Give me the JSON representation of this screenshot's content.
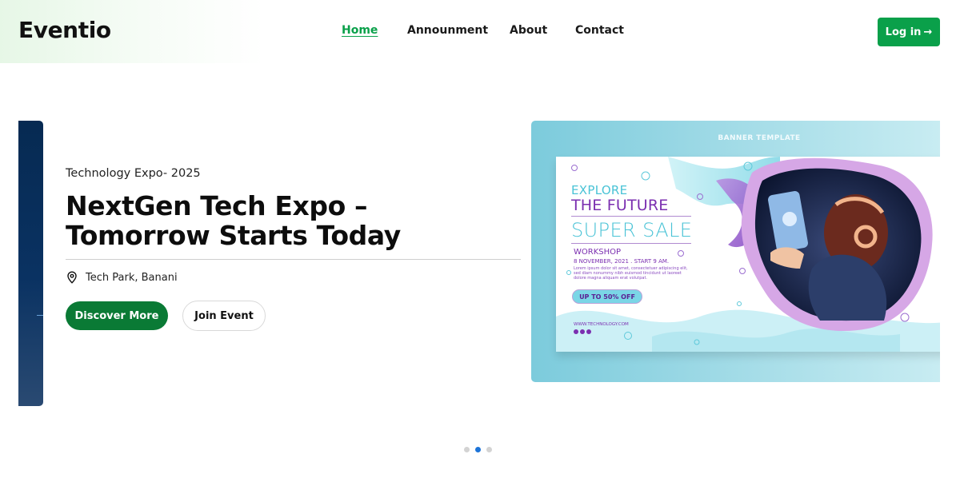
{
  "header": {
    "logo": "Eventio",
    "nav": [
      {
        "label": "Home",
        "active": true
      },
      {
        "label": "Announment",
        "active": false
      },
      {
        "label": "About",
        "active": false
      },
      {
        "label": "Contact",
        "active": false
      }
    ],
    "login_label": "Log in",
    "login_arrow": "→"
  },
  "hero": {
    "subtitle": "Technology Expo-  2025",
    "headline": "NextGen Tech Expo – Tomorrow Starts Today",
    "location": "Tech Park, Banani",
    "discover_label": "Discover More",
    "join_label": "Join Event",
    "banner": {
      "caption": "BANNER TEMPLATE",
      "explore": "EXPLORE",
      "future": "THE FUTURE",
      "sale": "SUPER SALE",
      "workshop": "WORKSHOP",
      "date": "8 NOVEMBER, 2021 . START 9 AM.",
      "lorem": "Lorem ipsum dolor sit amet, consectetuer adipiscing elit, sed diam nonummy nibh euismod tincidunt ut laoreet dolore magna aliquam erat volutpat.",
      "offer": "UP TO 50% OFF",
      "site": "WWW.TECHNOLOGY.COM"
    }
  },
  "slider": {
    "active_index": 1,
    "count": 3
  },
  "colors": {
    "brand_green": "#0aa04a",
    "button_dark_green": "#0a7a35",
    "active_dot": "#1d74d8",
    "inactive_dot": "#d3d3d3"
  }
}
